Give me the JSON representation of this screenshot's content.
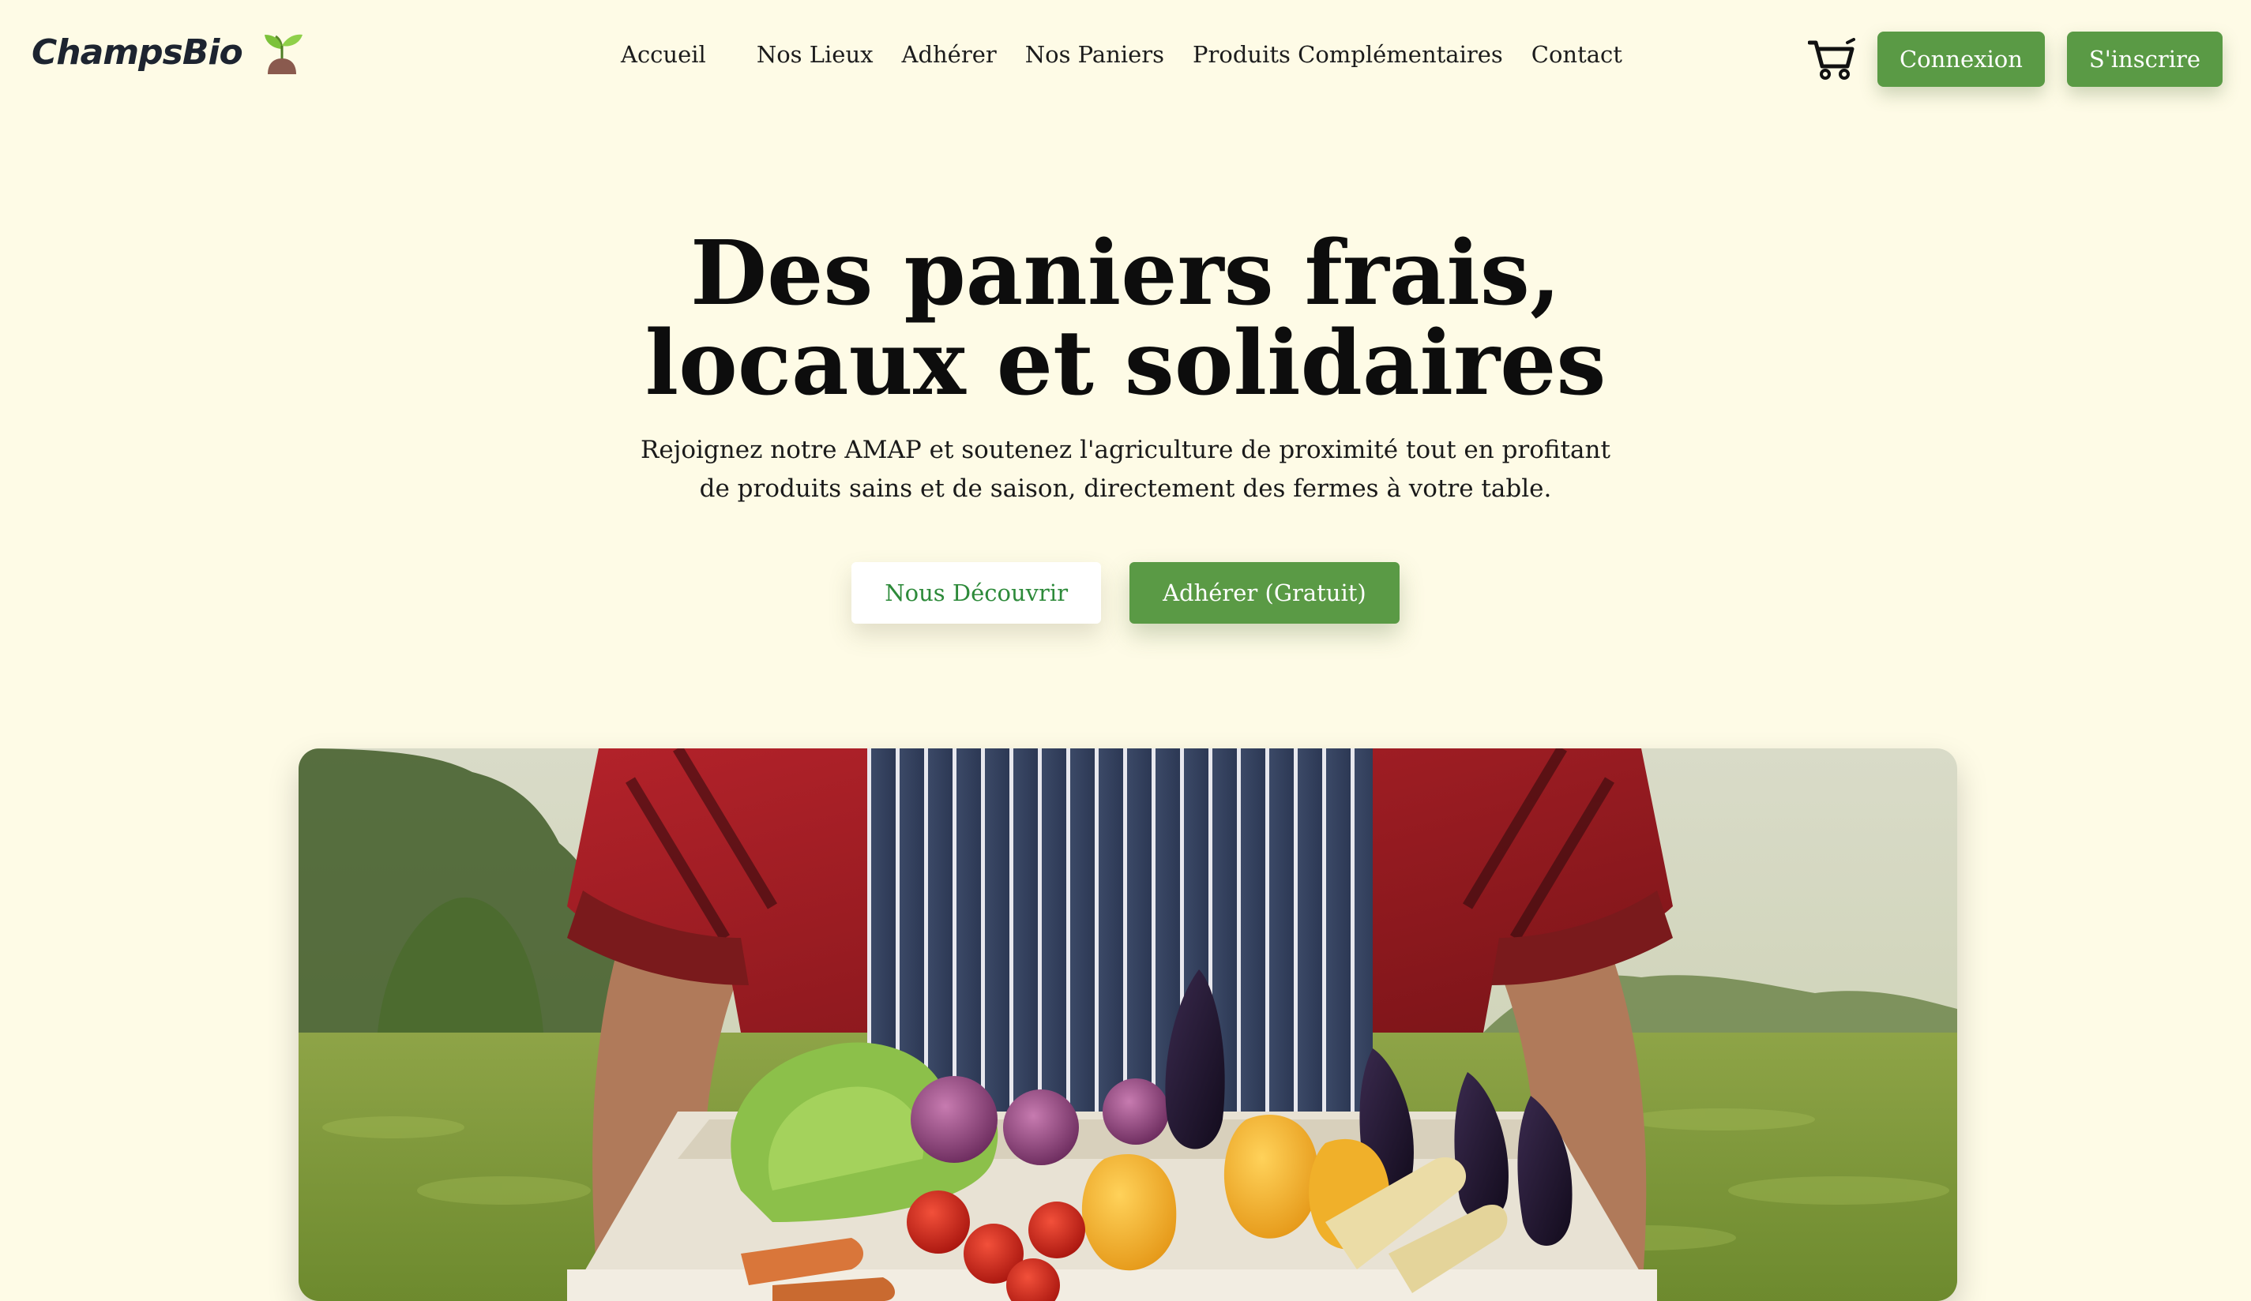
{
  "brand": {
    "name": "ChampsBio",
    "logo_icon": "sprout-icon"
  },
  "nav": {
    "links": [
      {
        "label": "Accueil"
      },
      {
        "label": "Nos Lieux"
      },
      {
        "label": "Adhérer"
      },
      {
        "label": "Nos Paniers"
      },
      {
        "label": "Produits Complémentaires"
      },
      {
        "label": "Contact"
      }
    ],
    "cart_icon": "shopping-cart-icon",
    "login_label": "Connexion",
    "signup_label": "S'inscrire"
  },
  "hero": {
    "title_line1": "Des paniers frais,",
    "title_line2": "locaux et solidaires",
    "subtitle_line1": "Rejoignez notre AMAP et soutenez l'agriculture de proximité tout en profitant",
    "subtitle_line2": "de produits sains et de saison, directement des fermes à votre table.",
    "discover_label": "Nous Découvrir",
    "join_label": "Adhérer (Gratuit)"
  },
  "colors": {
    "background": "#fefbe6",
    "brand_green": "#5a9a45",
    "accent_text_green": "#2d8a3a",
    "text_dark": "#0d0d0d"
  }
}
